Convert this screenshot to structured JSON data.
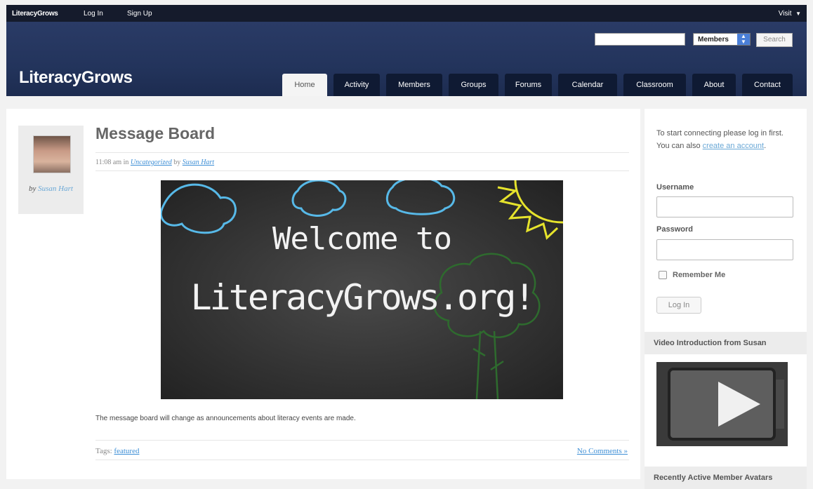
{
  "adminbar": {
    "logo": "LiteracyGrows",
    "login": "Log In",
    "signup": "Sign Up",
    "visit": "Visit"
  },
  "header": {
    "site_title": "LiteracyGrows",
    "search": {
      "value": "",
      "select_value": "Members",
      "button": "Search"
    },
    "nav": [
      "Home",
      "Activity",
      "Members",
      "Groups",
      "Forums",
      "Calendar",
      "Classroom",
      "About",
      "Contact"
    ],
    "active_tab": "Home"
  },
  "post": {
    "author_prefix": "by",
    "author": "Susan Hart",
    "title": "Message Board",
    "time": "11:08 am",
    "in_word": "in",
    "category": "Uncategorized",
    "by_word": "by",
    "image_line1": "Welcome to",
    "image_line2": "LiteracyGrows.org!",
    "body": "The message board will change as announcements about literacy events are made.",
    "tags_label": "Tags:",
    "tag": "featured",
    "comments": "No Comments »"
  },
  "sidebar": {
    "intro_text": "To start connecting please log in first. You can also",
    "intro_link": "create an account",
    "intro_end": ".",
    "username_label": "Username",
    "password_label": "Password",
    "remember": "Remember Me",
    "login_button": "Log In",
    "video_heading": "Video Introduction from Susan",
    "avatars_heading": "Recently Active Member Avatars"
  },
  "colors": {
    "header_bg": "#23345c",
    "adminbar_bg": "#151b2c",
    "tab_bg": "#0f1a33",
    "link": "#3e8fd6"
  }
}
